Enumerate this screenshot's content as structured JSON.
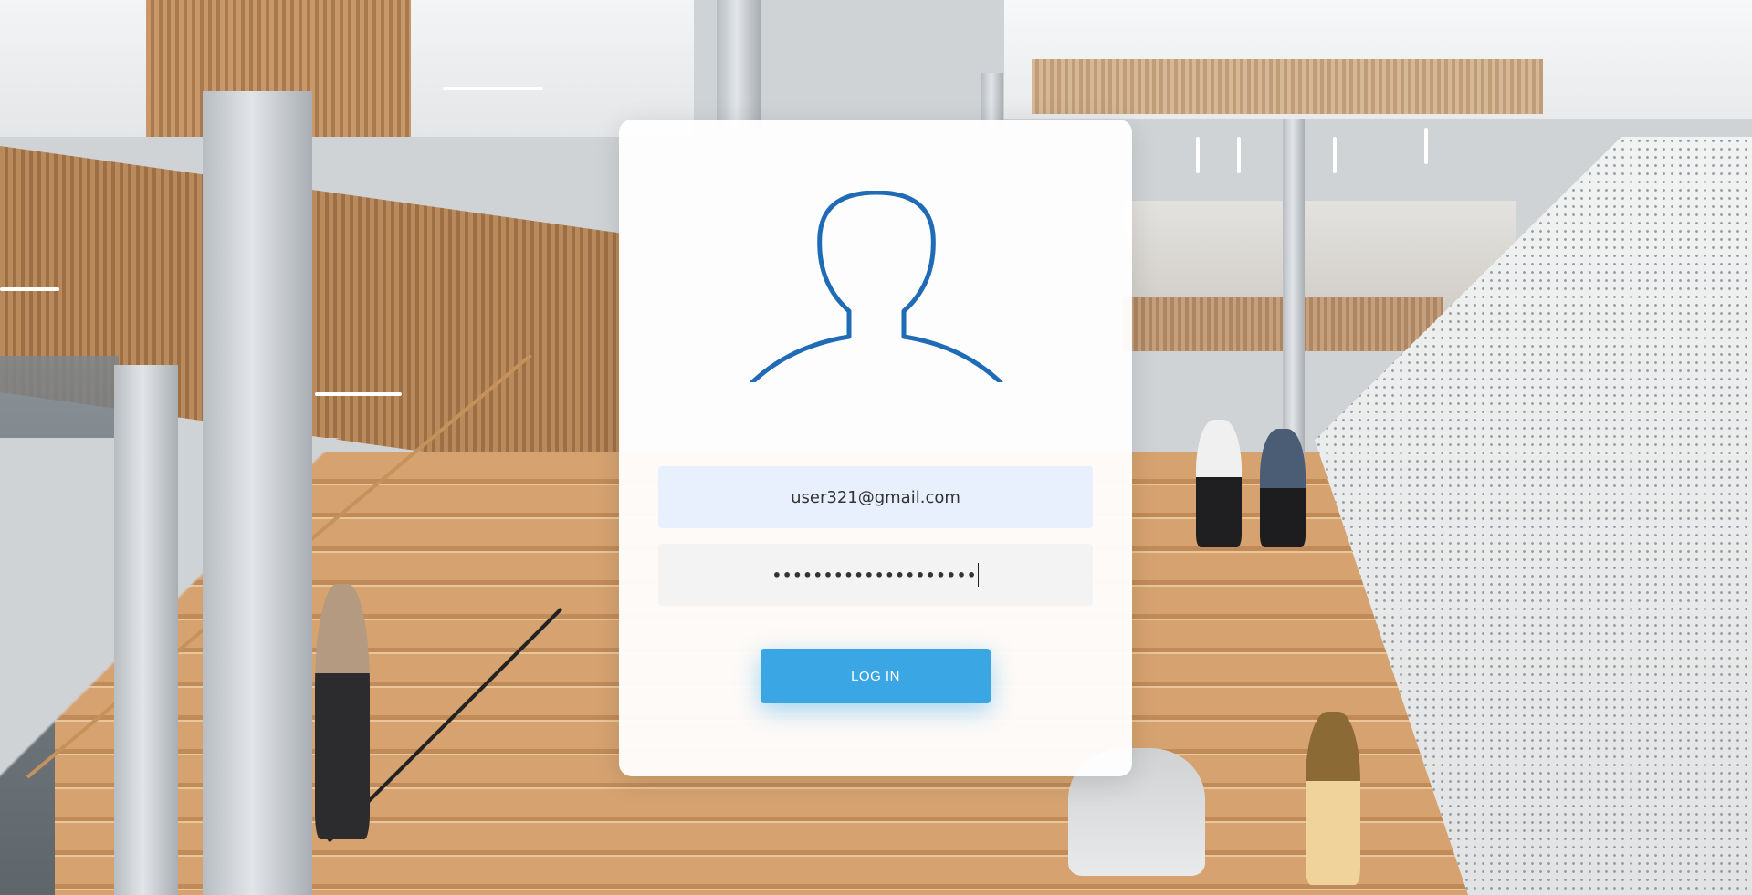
{
  "login": {
    "email_value": "user321@gmail.com",
    "password_mask": "••••••••••••••••••••",
    "login_label": "LOG IN"
  },
  "icons": {
    "avatar": "user-silhouette-icon"
  },
  "colors": {
    "avatar_stroke": "#1f6bb5",
    "button_bg": "#3aa6e3",
    "email_field_bg": "#e8f0fe"
  }
}
